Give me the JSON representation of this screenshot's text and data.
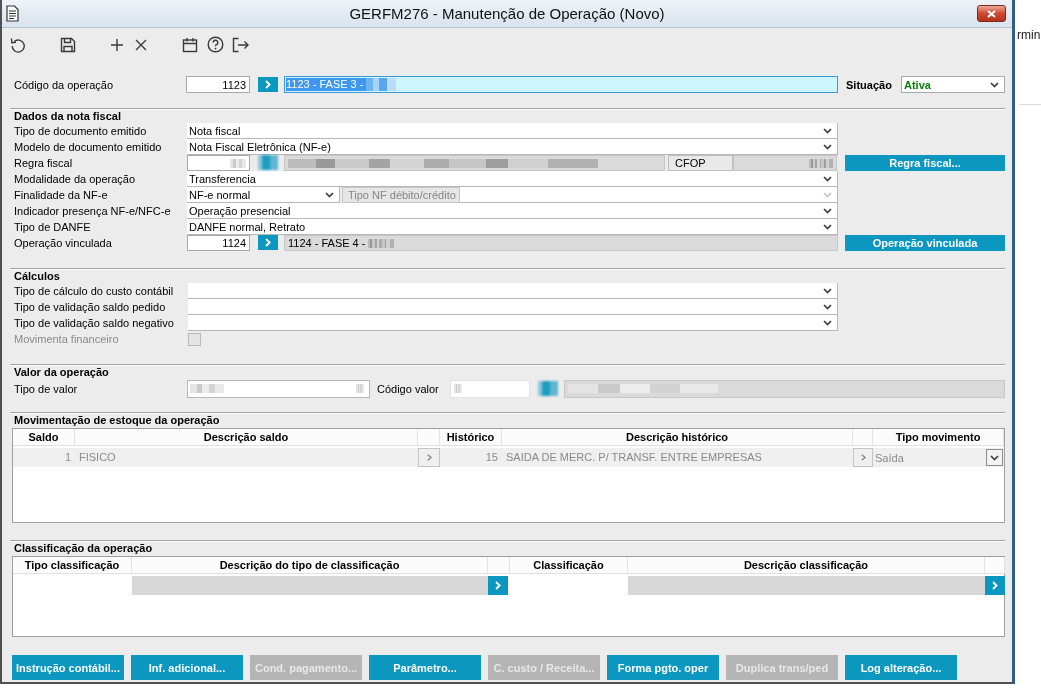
{
  "window": {
    "title": "GERFM276 - Manutenção de Operação (Novo)"
  },
  "operation": {
    "label": "Código da operação",
    "code": "1123",
    "description": "1123 - FASE 3 -",
    "description_redacted": true,
    "description_selected": true,
    "status_label": "Situação",
    "status": "Ativa"
  },
  "nota_fiscal": {
    "title": "Dados da nota fiscal",
    "rows": [
      {
        "kind": "select",
        "label": "Tipo de documento emitido",
        "value": "Nota fiscal"
      },
      {
        "kind": "select",
        "label": "Modelo de documento emitido",
        "value": "Nota Fiscal Eletrônica (NF-e)"
      },
      {
        "kind": "rule",
        "label": "Regra fiscal",
        "redacted": true,
        "cfop_label": "CFOP",
        "button": {
          "label": "Regra fiscal...",
          "disabled": false
        }
      },
      {
        "kind": "select",
        "label": "Modalidade da operação",
        "value": "Transferencia"
      },
      {
        "kind": "purpose",
        "label": "Finalidade da NF-e",
        "value": "NF-e normal",
        "button": {
          "label": "Tipo NF débito/crédito",
          "disabled": true
        },
        "secondary_disabled": true
      },
      {
        "kind": "select",
        "label": "Indicador presença NF-e/NFC-e",
        "value": "Operação presencial"
      },
      {
        "kind": "select",
        "label": "Tipo de DANFE",
        "value": "DANFE normal, Retrato"
      },
      {
        "kind": "link",
        "label": "Operação vinculada",
        "code": "1124",
        "description": "1124 - FASE 4 -",
        "redacted": true,
        "button": {
          "label": "Operação vinculada",
          "disabled": false
        }
      }
    ]
  },
  "calculos": {
    "title": "Cálculos",
    "rows": [
      {
        "kind": "select",
        "label": "Tipo de cálculo do custo contábil"
      },
      {
        "kind": "select",
        "label": "Tipo de validação saldo pedido"
      },
      {
        "kind": "select",
        "label": "Tipo de validação saldo negativo"
      },
      {
        "kind": "checkbox",
        "label": "Movimenta financeiro",
        "checked": false,
        "disabled": true
      }
    ]
  },
  "valor": {
    "title": "Valor da operação",
    "type_label": "Tipo de valor",
    "code_label": "Código valor",
    "redacted": true
  },
  "estoque": {
    "title": "Movimentação de estoque da operação",
    "columns": [
      "Saldo",
      "Descrição saldo",
      "Histórico",
      "Descrição histórico",
      "Tipo movimento"
    ],
    "rows": [
      {
        "saldo": "1",
        "descricao_saldo": "FISICO",
        "historico": "15",
        "descricao_historico": "SAIDA DE MERC. P/ TRANSF. ENTRE EMPRESAS",
        "tipo_movimento": "Saída",
        "disabled": true
      }
    ]
  },
  "classificacao": {
    "title": "Classificação da operação",
    "columns": [
      "Tipo classificação",
      "Descrição do tipo de classificação",
      "Classificação",
      "Descrição classificação"
    ],
    "rows": [
      {
        "disabled": false
      }
    ]
  },
  "actions": [
    {
      "label": "Instrução contábil...",
      "disabled": false
    },
    {
      "label": "Inf. adicional...",
      "disabled": false
    },
    {
      "label": "Cond. pagamento...",
      "disabled": true
    },
    {
      "label": "Parâmetro...",
      "disabled": false
    },
    {
      "label": "C. custo / Receita...",
      "disabled": true
    },
    {
      "label": "Forma pgto. oper",
      "disabled": false
    },
    {
      "label": "Duplica trans/ped",
      "disabled": true
    },
    {
      "label": "Log alteração...",
      "disabled": false
    }
  ],
  "background_window": {
    "text": "rmin"
  }
}
